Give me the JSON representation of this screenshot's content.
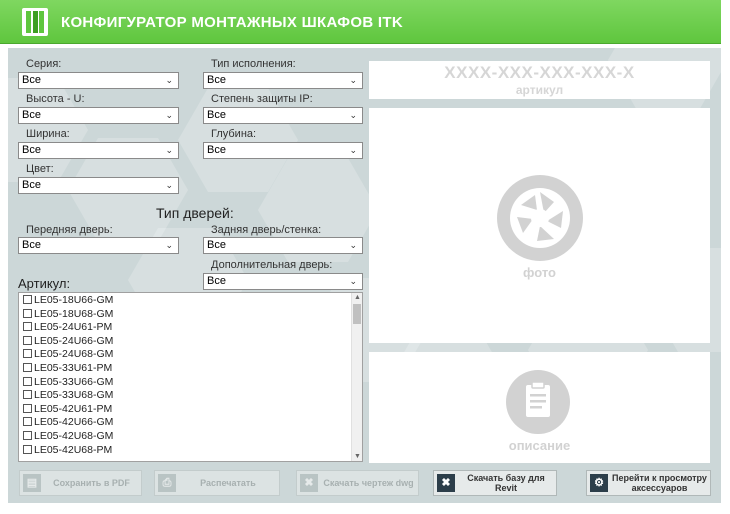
{
  "header": {
    "title": "КОНФИГУРАТОР МОНТАЖНЫХ ШКАФОВ ITK"
  },
  "filters": {
    "series": {
      "label": "Серия:",
      "value": "Все"
    },
    "height": {
      "label": "Высота - U:",
      "value": "Все"
    },
    "width": {
      "label": "Ширина:",
      "value": "Все"
    },
    "color": {
      "label": "Цвет:",
      "value": "Все"
    },
    "type": {
      "label": "Тип исполнения:",
      "value": "Все"
    },
    "protection": {
      "label": "Степень защиты IP:",
      "value": "Все"
    },
    "depth": {
      "label": "Глубина:",
      "value": "Все"
    }
  },
  "doors": {
    "title": "Тип дверей:",
    "front": {
      "label": "Передняя дверь:",
      "value": "Все"
    },
    "rear": {
      "label": "Задняя дверь/стенка:",
      "value": "Все"
    },
    "extra": {
      "label": "Дополнительная дверь:",
      "value": "Все"
    }
  },
  "article": {
    "title": "Артикул:",
    "code": "XXXX-XXX-XXX-XXX-X",
    "code_caption": "артикул",
    "items": [
      "LE05-18U66-GM",
      "LE05-18U68-GM",
      "LE05-24U61-PM",
      "LE05-24U66-GM",
      "LE05-24U68-GM",
      "LE05-33U61-PM",
      "LE05-33U66-GM",
      "LE05-33U68-GM",
      "LE05-42U61-PM",
      "LE05-42U66-GM",
      "LE05-42U68-GM",
      "LE05-42U68-PM"
    ]
  },
  "photo": {
    "caption": "фото",
    "icon": "camera-shutter-icon"
  },
  "description": {
    "caption": "описание",
    "icon": "clipboard-icon"
  },
  "buttons": {
    "pdf": "Сохранить в PDF",
    "print": "Распечатать",
    "dwg": "Скачать чертеж dwg",
    "revit": "Скачать базу для Revit",
    "accessories": "Перейти к просмотру аксессуаров"
  },
  "colors": {
    "header_green": "#5fc63e",
    "panel": "#ccd7d8",
    "placeholder_gray": "#d2d2d2"
  }
}
